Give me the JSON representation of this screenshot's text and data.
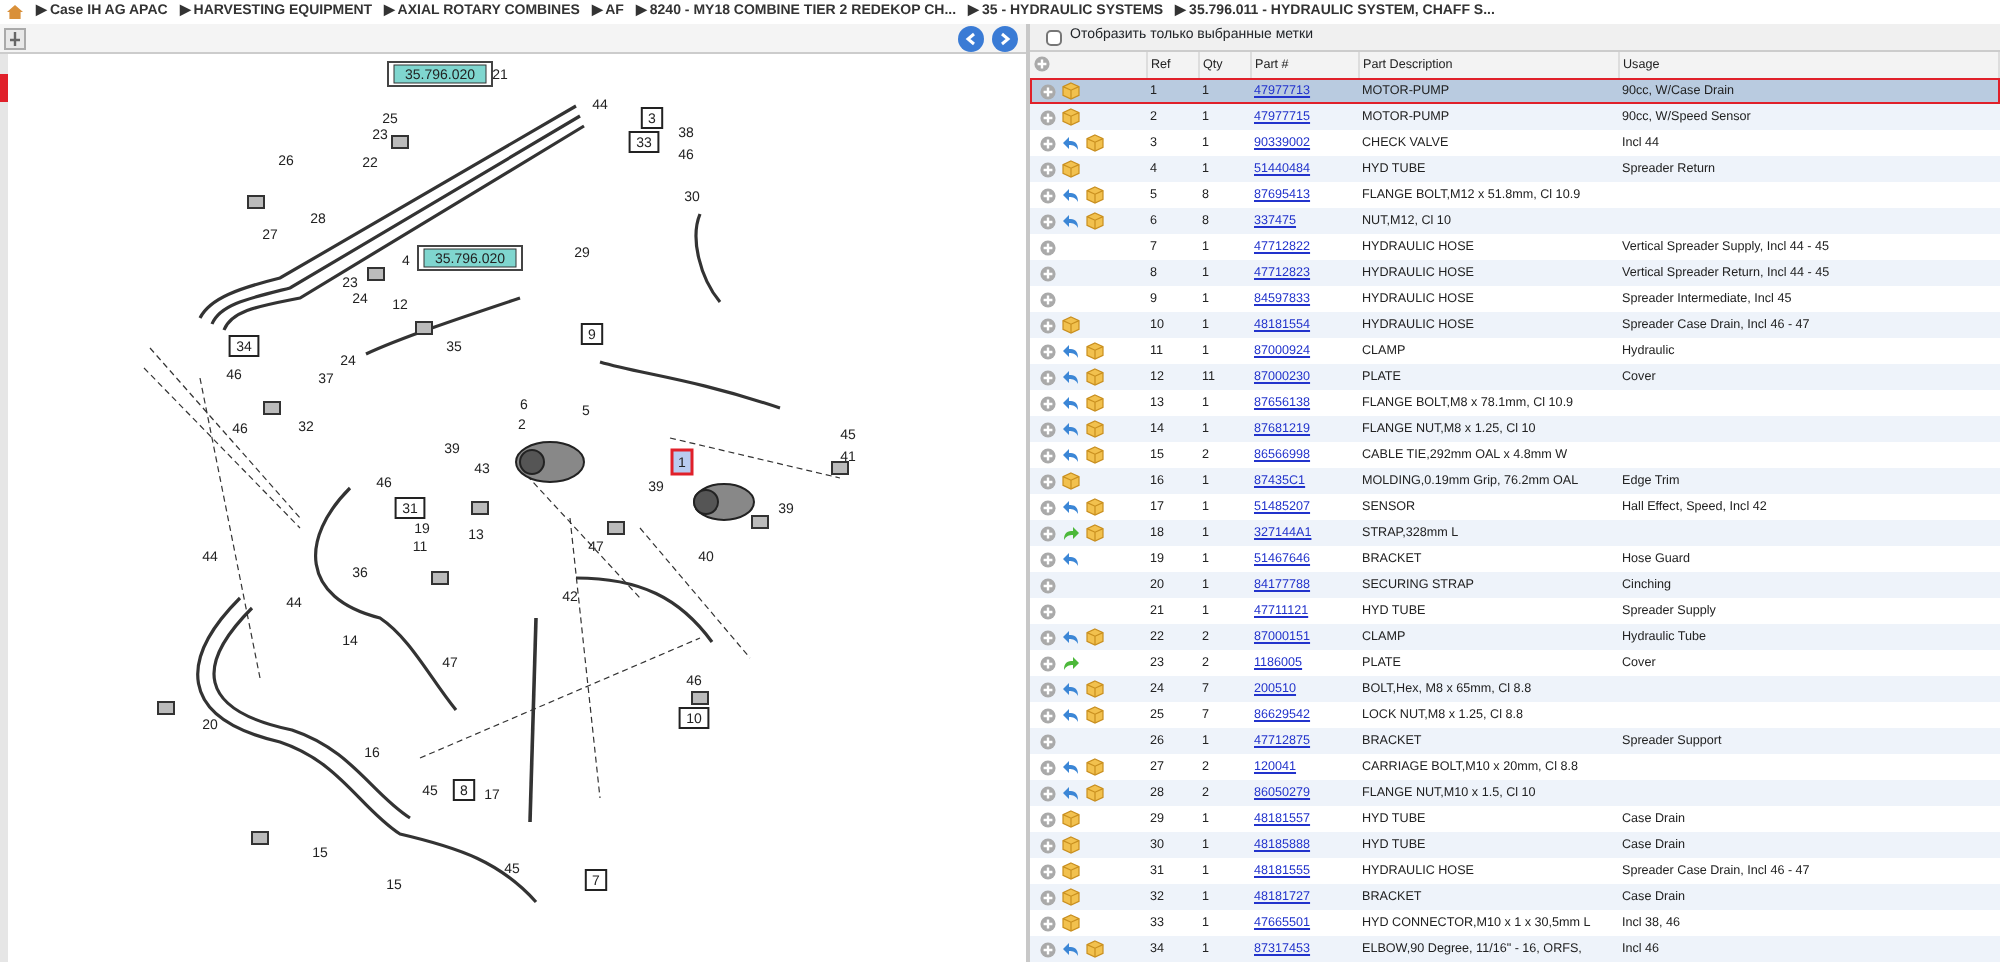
{
  "breadcrumb": [
    {
      "label": "▶ Case IH AG APAC"
    },
    {
      "label": "▶ HARVESTING EQUIPMENT"
    },
    {
      "label": "▶ AXIAL ROTARY COMBINES"
    },
    {
      "label": "▶ AF"
    },
    {
      "label": "▶ 8240 - MY18 COMBINE TIER 2 REDEKOP CH..."
    },
    {
      "label": "▶ 35 - HYDRAULIC SYSTEMS"
    },
    {
      "label": "▶ 35.796.011 - HYDRAULIC SYSTEM, CHAFF S..."
    }
  ],
  "filter": {
    "label": "Отобразить только выбранные метки",
    "checked": false
  },
  "callouts": [
    {
      "label": "35.796.020",
      "kind": "link"
    },
    {
      "label": "21",
      "kind": "plain"
    },
    {
      "label": "44",
      "kind": "plain"
    },
    {
      "label": "3",
      "kind": "boxed"
    },
    {
      "label": "33",
      "kind": "boxed"
    },
    {
      "label": "38",
      "kind": "plain"
    },
    {
      "label": "46",
      "kind": "plain"
    },
    {
      "label": "30",
      "kind": "plain"
    },
    {
      "label": "25",
      "kind": "plain"
    },
    {
      "label": "23",
      "kind": "plain"
    },
    {
      "label": "22",
      "kind": "plain"
    },
    {
      "label": "26",
      "kind": "plain"
    },
    {
      "label": "28",
      "kind": "plain"
    },
    {
      "label": "27",
      "kind": "plain"
    },
    {
      "label": "4",
      "kind": "plain"
    },
    {
      "label": "35.796.020",
      "kind": "link"
    },
    {
      "label": "29",
      "kind": "plain"
    },
    {
      "label": "23",
      "kind": "plain"
    },
    {
      "label": "24",
      "kind": "plain"
    },
    {
      "label": "12",
      "kind": "plain"
    },
    {
      "label": "35",
      "kind": "plain"
    },
    {
      "label": "9",
      "kind": "boxed"
    },
    {
      "label": "34",
      "kind": "boxed"
    },
    {
      "label": "46",
      "kind": "plain"
    },
    {
      "label": "37",
      "kind": "plain"
    },
    {
      "label": "24",
      "kind": "plain"
    },
    {
      "label": "46",
      "kind": "plain"
    },
    {
      "label": "32",
      "kind": "plain"
    },
    {
      "label": "6",
      "kind": "plain"
    },
    {
      "label": "2",
      "kind": "plain"
    },
    {
      "label": "5",
      "kind": "plain"
    },
    {
      "label": "39",
      "kind": "plain"
    },
    {
      "label": "43",
      "kind": "plain"
    },
    {
      "label": "39",
      "kind": "plain"
    },
    {
      "label": "1",
      "kind": "selected"
    },
    {
      "label": "45",
      "kind": "plain"
    },
    {
      "label": "41",
      "kind": "plain"
    },
    {
      "label": "39",
      "kind": "plain"
    },
    {
      "label": "40",
      "kind": "plain"
    },
    {
      "label": "46",
      "kind": "plain"
    },
    {
      "label": "31",
      "kind": "boxed"
    },
    {
      "label": "19",
      "kind": "plain"
    },
    {
      "label": "13",
      "kind": "plain"
    },
    {
      "label": "11",
      "kind": "plain"
    },
    {
      "label": "36",
      "kind": "plain"
    },
    {
      "label": "47",
      "kind": "plain"
    },
    {
      "label": "42",
      "kind": "plain"
    },
    {
      "label": "14",
      "kind": "plain"
    },
    {
      "label": "44",
      "kind": "plain"
    },
    {
      "label": "44",
      "kind": "plain"
    },
    {
      "label": "20",
      "kind": "plain"
    },
    {
      "label": "47",
      "kind": "plain"
    },
    {
      "label": "46",
      "kind": "plain"
    },
    {
      "label": "10",
      "kind": "boxed"
    },
    {
      "label": "16",
      "kind": "plain"
    },
    {
      "label": "45",
      "kind": "plain"
    },
    {
      "label": "8",
      "kind": "boxed"
    },
    {
      "label": "17",
      "kind": "plain"
    },
    {
      "label": "15",
      "kind": "plain"
    },
    {
      "label": "15",
      "kind": "plain"
    },
    {
      "label": "45",
      "kind": "plain"
    },
    {
      "label": "7",
      "kind": "boxed"
    }
  ],
  "table": {
    "columns": [
      "Ref",
      "Qty",
      "Part #",
      "Part Description",
      "Usage"
    ],
    "rows": [
      {
        "ref": "1",
        "qty": "1",
        "part": "47977713",
        "description": "MOTOR-PUMP",
        "usage": "90cc, W/Case Drain",
        "arrow_left": false,
        "arrow_right": false,
        "box": true,
        "selected": true
      },
      {
        "ref": "2",
        "qty": "1",
        "part": "47977715",
        "description": "MOTOR-PUMP",
        "usage": "90cc, W/Speed Sensor",
        "arrow_left": false,
        "arrow_right": false,
        "box": true,
        "selected": false
      },
      {
        "ref": "3",
        "qty": "1",
        "part": "90339002",
        "description": "CHECK VALVE",
        "usage": "Incl 44",
        "arrow_left": true,
        "arrow_right": false,
        "box": true,
        "selected": false
      },
      {
        "ref": "4",
        "qty": "1",
        "part": "51440484",
        "description": "HYD TUBE",
        "usage": "Spreader Return",
        "arrow_left": false,
        "arrow_right": false,
        "box": true,
        "selected": false
      },
      {
        "ref": "5",
        "qty": "8",
        "part": "87695413",
        "description": "FLANGE BOLT,M12 x 51.8mm, Cl 10.9",
        "arrow_left": true,
        "arrow_right": false,
        "box": true,
        "selected": false
      },
      {
        "ref": "6",
        "qty": "8",
        "part": "337475",
        "description": "NUT,M12, Cl 10",
        "arrow_left": true,
        "arrow_right": false,
        "box": true,
        "selected": false
      },
      {
        "ref": "7",
        "qty": "1",
        "part": "47712822",
        "description": "HYDRAULIC HOSE",
        "usage": "Vertical Spreader Supply, Incl 44 - 45",
        "arrow_left": false,
        "arrow_right": false,
        "box": false,
        "selected": false
      },
      {
        "ref": "8",
        "qty": "1",
        "part": "47712823",
        "description": "HYDRAULIC HOSE",
        "usage": "Vertical Spreader Return, Incl 44 - 45",
        "arrow_left": false,
        "arrow_right": false,
        "box": false,
        "selected": false
      },
      {
        "ref": "9",
        "qty": "1",
        "part": "84597833",
        "description": "HYDRAULIC HOSE",
        "usage": "Spreader Intermediate, Incl 45",
        "arrow_left": false,
        "arrow_right": false,
        "box": false,
        "selected": false
      },
      {
        "ref": "10",
        "qty": "1",
        "part": "48181554",
        "description": "HYDRAULIC HOSE",
        "usage": "Spreader Case Drain, Incl 46 - 47",
        "arrow_left": false,
        "arrow_right": false,
        "box": true,
        "selected": false
      },
      {
        "ref": "11",
        "qty": "1",
        "part": "87000924",
        "description": "CLAMP",
        "usage": "Hydraulic",
        "arrow_left": true,
        "arrow_right": false,
        "box": true,
        "selected": false
      },
      {
        "ref": "12",
        "qty": "11",
        "part": "87000230",
        "description": "PLATE",
        "usage": "Cover",
        "arrow_left": true,
        "arrow_right": false,
        "box": true,
        "selected": false
      },
      {
        "ref": "13",
        "qty": "1",
        "part": "87656138",
        "description": "FLANGE BOLT,M8 x 78.1mm, Cl 10.9",
        "arrow_left": true,
        "arrow_right": false,
        "box": true,
        "selected": false
      },
      {
        "ref": "14",
        "qty": "1",
        "part": "87681219",
        "description": "FLANGE NUT,M8 x 1.25, Cl 10",
        "arrow_left": true,
        "arrow_right": false,
        "box": true,
        "selected": false
      },
      {
        "ref": "15",
        "qty": "2",
        "part": "86566998",
        "description": "CABLE TIE,292mm OAL x 4.8mm W",
        "arrow_left": true,
        "arrow_right": false,
        "box": true,
        "selected": false
      },
      {
        "ref": "16",
        "qty": "1",
        "part": "87435C1",
        "description": "MOLDING,0.19mm Grip, 76.2mm OAL",
        "usage": "Edge Trim",
        "arrow_left": false,
        "arrow_right": false,
        "box": true,
        "selected": false
      },
      {
        "ref": "17",
        "qty": "1",
        "part": "51485207",
        "description": "SENSOR",
        "usage": "Hall Effect, Speed, Incl 42",
        "arrow_left": true,
        "arrow_right": false,
        "box": true,
        "selected": false
      },
      {
        "ref": "18",
        "qty": "1",
        "part": "327144A1",
        "description": "STRAP,328mm L",
        "arrow_left": false,
        "arrow_right": true,
        "box": true,
        "selected": false
      },
      {
        "ref": "19",
        "qty": "1",
        "part": "51467646",
        "description": "BRACKET",
        "usage": "Hose Guard",
        "arrow_left": true,
        "arrow_right": false,
        "box": false,
        "selected": false
      },
      {
        "ref": "20",
        "qty": "1",
        "part": "84177788",
        "description": "SECURING STRAP",
        "usage": "Cinching",
        "arrow_left": false,
        "arrow_right": false,
        "box": false,
        "selected": false
      },
      {
        "ref": "21",
        "qty": "1",
        "part": "47711121",
        "description": "HYD TUBE",
        "usage": "Spreader Supply",
        "arrow_left": false,
        "arrow_right": false,
        "box": false,
        "selected": false
      },
      {
        "ref": "22",
        "qty": "2",
        "part": "87000151",
        "description": "CLAMP",
        "usage": "Hydraulic Tube",
        "arrow_left": true,
        "arrow_right": false,
        "box": true,
        "selected": false
      },
      {
        "ref": "23",
        "qty": "2",
        "part": "1186005",
        "description": "PLATE",
        "usage": "Cover",
        "arrow_left": false,
        "arrow_right": true,
        "box": false,
        "selected": false
      },
      {
        "ref": "24",
        "qty": "7",
        "part": "200510",
        "description": "BOLT,Hex, M8 x 65mm, Cl 8.8",
        "arrow_left": true,
        "arrow_right": false,
        "box": true,
        "selected": false
      },
      {
        "ref": "25",
        "qty": "7",
        "part": "86629542",
        "description": "LOCK NUT,M8 x 1.25, Cl 8.8",
        "arrow_left": true,
        "arrow_right": false,
        "box": true,
        "selected": false
      },
      {
        "ref": "26",
        "qty": "1",
        "part": "47712875",
        "description": "BRACKET",
        "usage": "Spreader Support",
        "arrow_left": false,
        "arrow_right": false,
        "box": false,
        "selected": false
      },
      {
        "ref": "27",
        "qty": "2",
        "part": "120041",
        "description": "CARRIAGE BOLT,M10 x 20mm, Cl 8.8",
        "arrow_left": true,
        "arrow_right": false,
        "box": true,
        "selected": false
      },
      {
        "ref": "28",
        "qty": "2",
        "part": "86050279",
        "description": "FLANGE NUT,M10 x 1.5, Cl 10",
        "arrow_left": true,
        "arrow_right": false,
        "box": true,
        "selected": false
      },
      {
        "ref": "29",
        "qty": "1",
        "part": "48181557",
        "description": "HYD TUBE",
        "usage": "Case Drain",
        "arrow_left": false,
        "arrow_right": false,
        "box": true,
        "selected": false
      },
      {
        "ref": "30",
        "qty": "1",
        "part": "48185888",
        "description": "HYD TUBE",
        "usage": "Case Drain",
        "arrow_left": false,
        "arrow_right": false,
        "box": true,
        "selected": false
      },
      {
        "ref": "31",
        "qty": "1",
        "part": "48181555",
        "description": "HYDRAULIC HOSE",
        "usage": "Spreader Case Drain, Incl 46 - 47",
        "arrow_left": false,
        "arrow_right": false,
        "box": true,
        "selected": false
      },
      {
        "ref": "32",
        "qty": "1",
        "part": "48181727",
        "description": "BRACKET",
        "usage": "Case Drain",
        "arrow_left": false,
        "arrow_right": false,
        "box": true,
        "selected": false
      },
      {
        "ref": "33",
        "qty": "1",
        "part": "47665501",
        "description": "HYD CONNECTOR,M10 x 1 x 30,5mm L",
        "usage": "Incl 38, 46",
        "arrow_left": false,
        "arrow_right": false,
        "box": true,
        "selected": false
      },
      {
        "ref": "34",
        "qty": "1",
        "part": "87317453",
        "description": "ELBOW,90 Degree, 11/16\" - 16, ORFS,",
        "usage": "Incl 46",
        "arrow_left": true,
        "arrow_right": false,
        "box": true,
        "selected": false
      }
    ]
  }
}
